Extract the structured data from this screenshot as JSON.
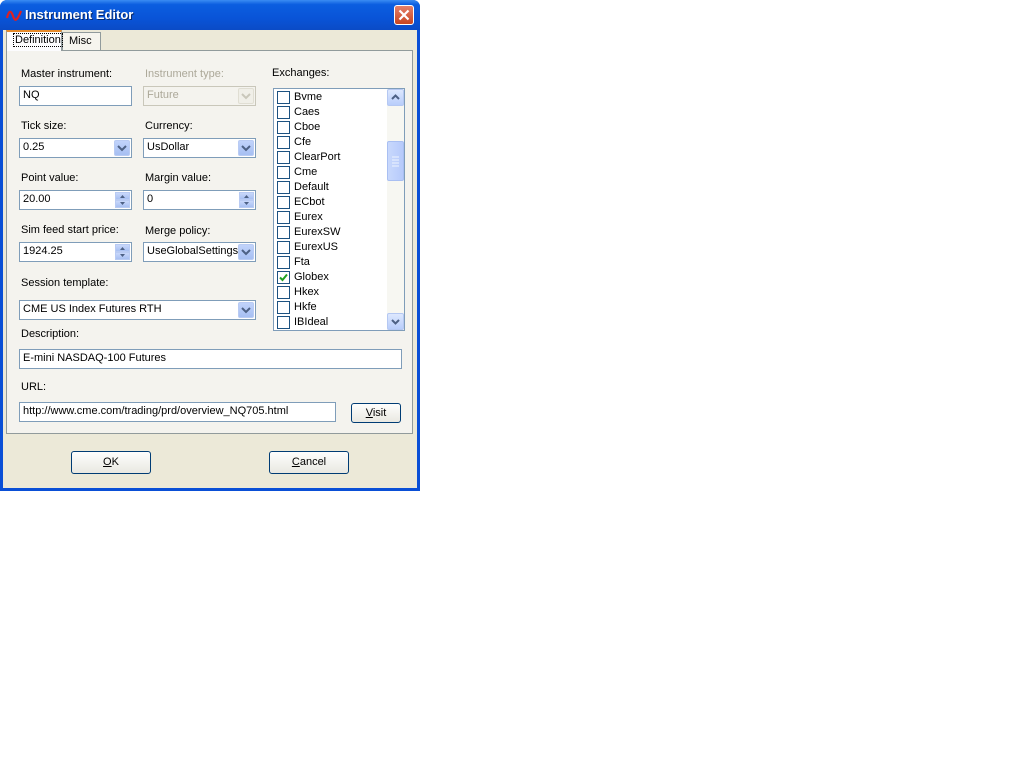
{
  "window": {
    "title": "Instrument Editor"
  },
  "tabs": [
    {
      "label": "Definition"
    },
    {
      "label": "Misc"
    }
  ],
  "fields": {
    "master_instrument": {
      "label": "Master instrument:",
      "value": "NQ"
    },
    "instrument_type": {
      "label": "Instrument type:",
      "value": "Future"
    },
    "tick_size": {
      "label": "Tick size:",
      "value": "0.25"
    },
    "currency": {
      "label": "Currency:",
      "value": "UsDollar"
    },
    "point_value": {
      "label": "Point value:",
      "value": "20.00"
    },
    "margin_value": {
      "label": "Margin value:",
      "value": "0"
    },
    "sim_feed_start_price": {
      "label": "Sim feed start price:",
      "value": "1924.25"
    },
    "merge_policy": {
      "label": "Merge policy:",
      "value": "UseGlobalSettings"
    },
    "session_template": {
      "label": "Session template:",
      "value": "CME US Index Futures RTH"
    },
    "description": {
      "label": "Description:",
      "value": "E-mini NASDAQ-100 Futures"
    },
    "url": {
      "label": "URL:",
      "value": "http://www.cme.com/trading/prd/overview_NQ705.html"
    }
  },
  "exchanges": {
    "label": "Exchanges:",
    "items": [
      {
        "name": "Bvme",
        "checked": false
      },
      {
        "name": "Caes",
        "checked": false
      },
      {
        "name": "Cboe",
        "checked": false
      },
      {
        "name": "Cfe",
        "checked": false
      },
      {
        "name": "ClearPort",
        "checked": false
      },
      {
        "name": "Cme",
        "checked": false
      },
      {
        "name": "Default",
        "checked": false
      },
      {
        "name": "ECbot",
        "checked": false
      },
      {
        "name": "Eurex",
        "checked": false
      },
      {
        "name": "EurexSW",
        "checked": false
      },
      {
        "name": "EurexUS",
        "checked": false
      },
      {
        "name": "Fta",
        "checked": false
      },
      {
        "name": "Globex",
        "checked": true
      },
      {
        "name": "Hkex",
        "checked": false
      },
      {
        "name": "Hkfe",
        "checked": false
      },
      {
        "name": "IBIdeal",
        "checked": false
      }
    ]
  },
  "buttons": {
    "visit_label": "Visit",
    "ok_label": "OK",
    "cancel_label": "Cancel"
  },
  "colors": {
    "titlebar": "#0a4fd6",
    "dialog_bg": "#ece9d8",
    "check": "#21a121"
  }
}
